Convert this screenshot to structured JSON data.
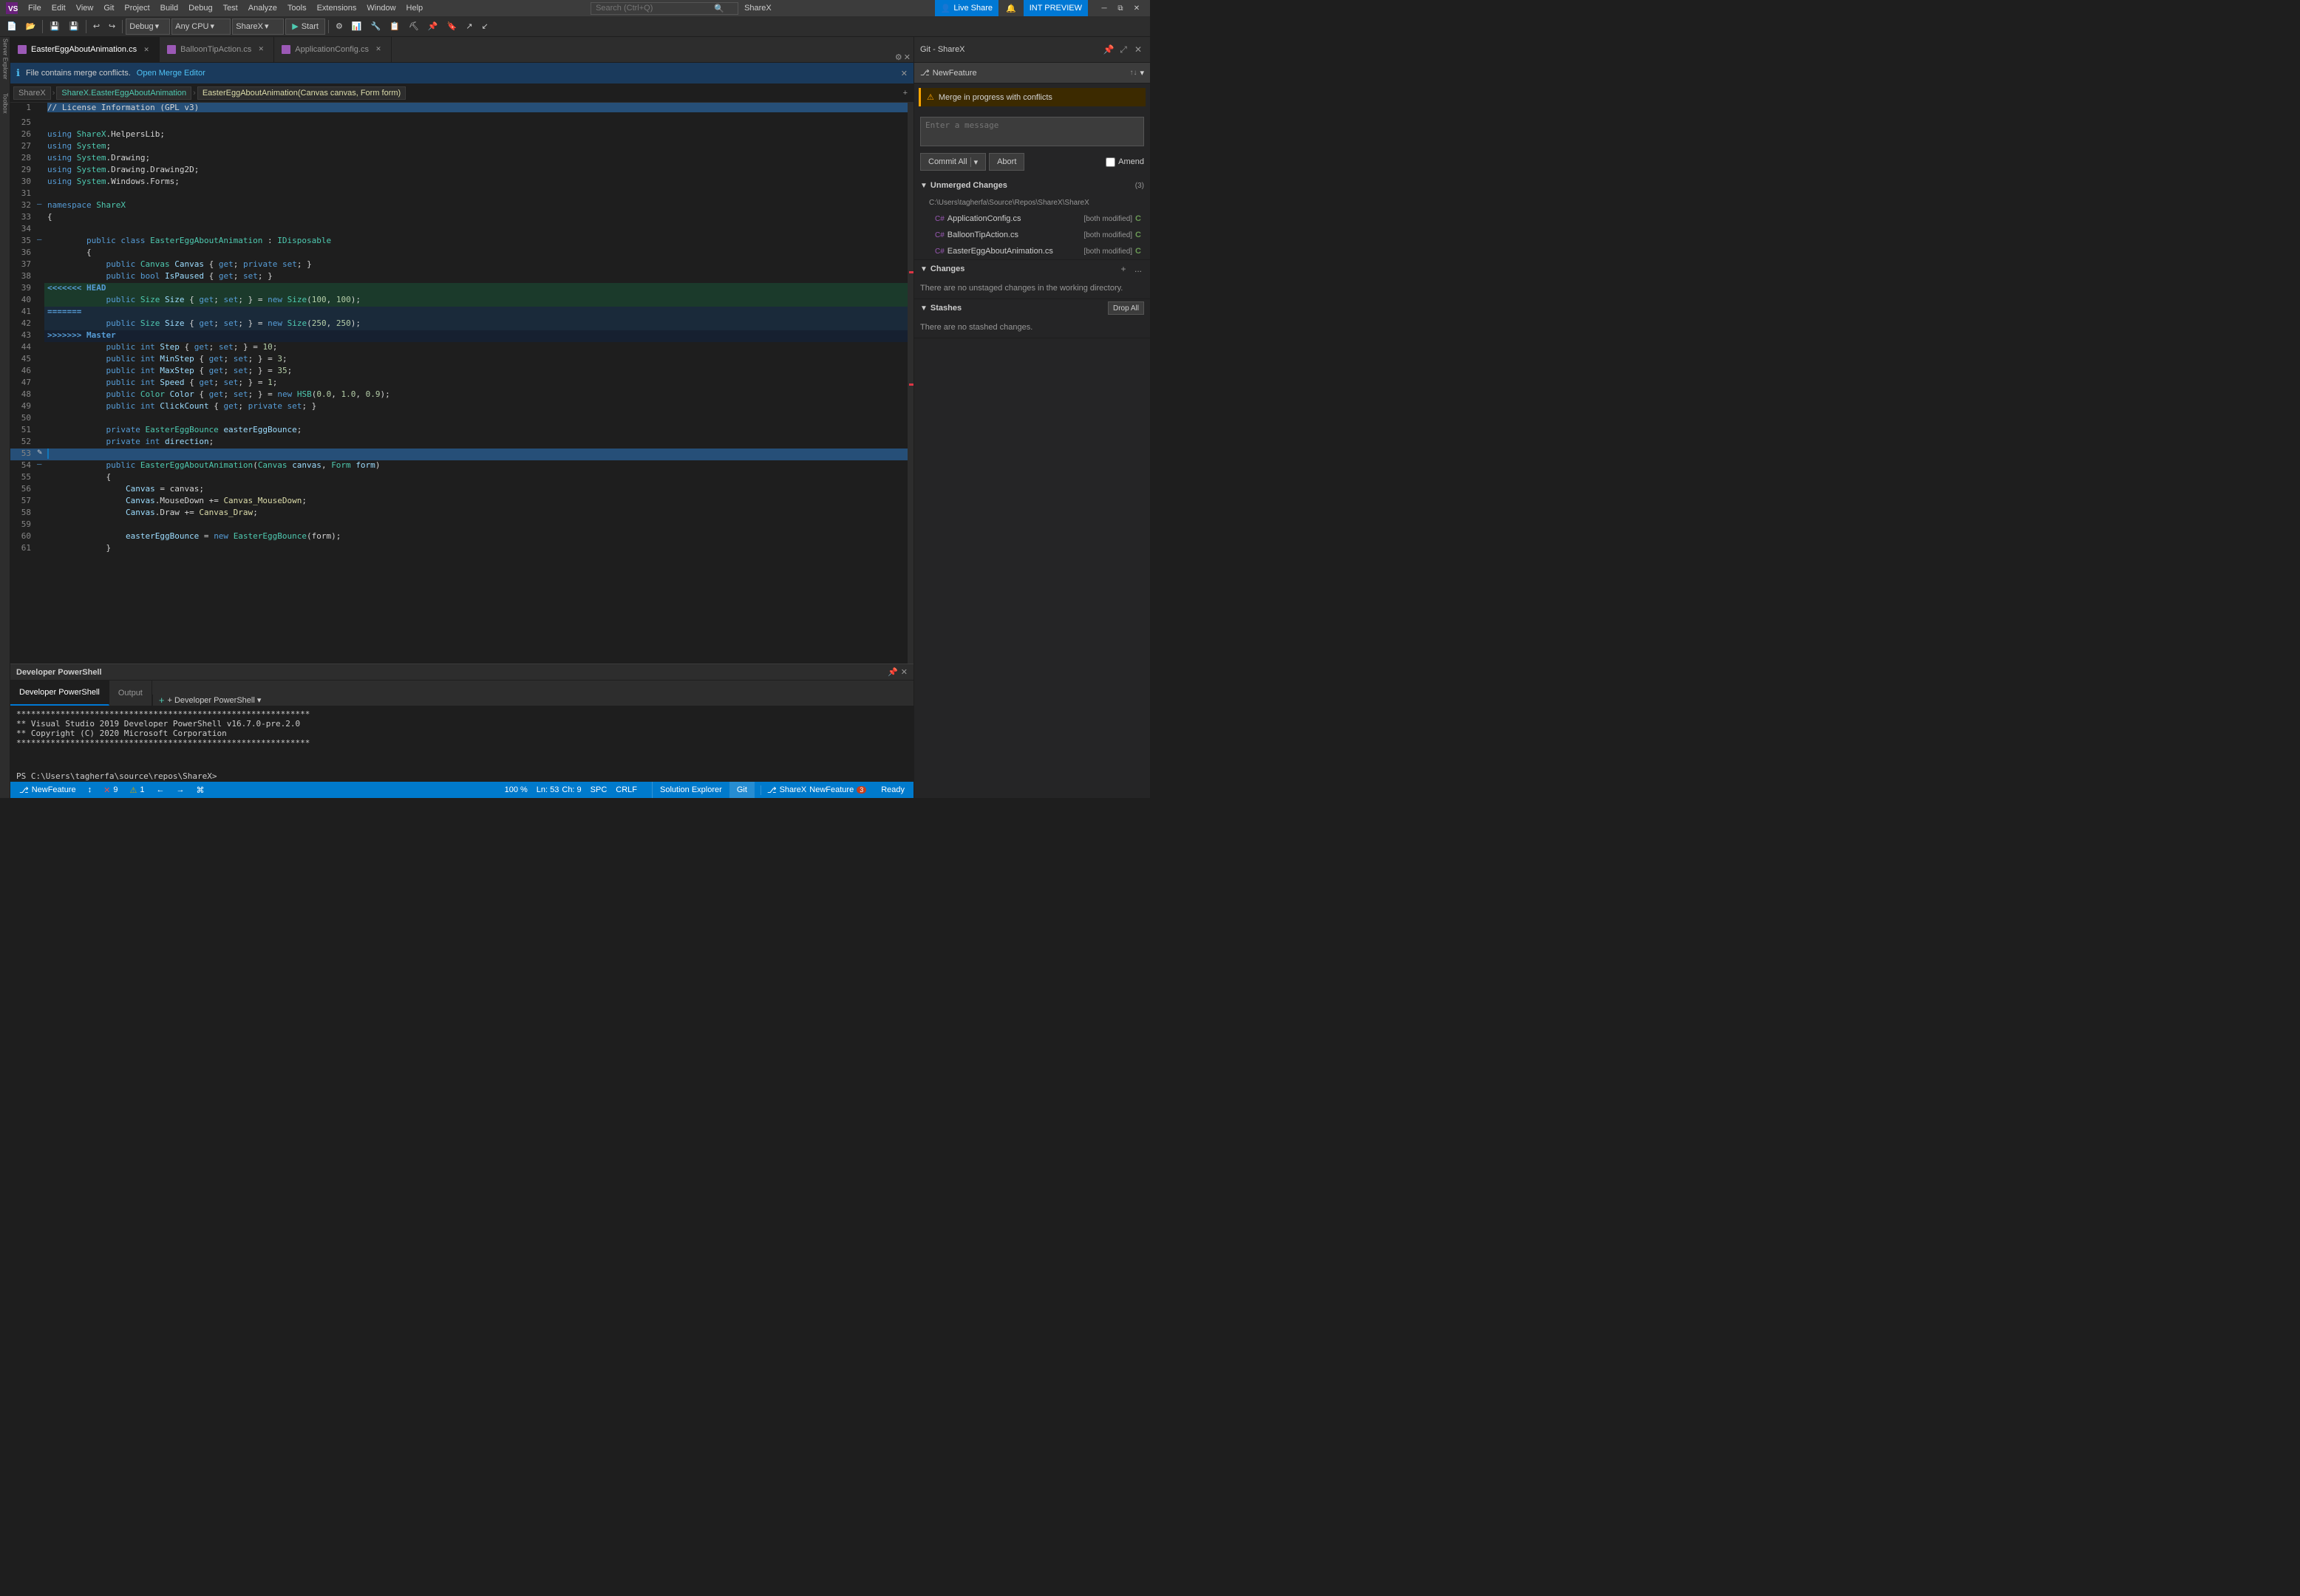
{
  "titleBar": {
    "appName": "ShareX",
    "menuItems": [
      "File",
      "Edit",
      "View",
      "Git",
      "Project",
      "Build",
      "Debug",
      "Test",
      "Analyze",
      "Tools",
      "Extensions",
      "Window",
      "Help"
    ],
    "searchPlaceholder": "Search (Ctrl+Q)",
    "searchText": "",
    "controls": [
      "minimize",
      "restore",
      "close"
    ]
  },
  "toolbar": {
    "debugConfig": "Debug",
    "platform": "Any CPU",
    "startProject": "ShareX",
    "startLabel": "Start",
    "liveShareLabel": "Live Share",
    "intPreviewLabel": "INT PREVIEW"
  },
  "tabs": [
    {
      "label": "EasterEggAboutAnimation.cs",
      "active": true,
      "modified": false
    },
    {
      "label": "BalloonTipAction.cs",
      "active": false,
      "modified": false
    },
    {
      "label": "ApplicationConfig.cs",
      "active": false,
      "modified": false
    }
  ],
  "mergeBar": {
    "icon": "ℹ",
    "text": "File contains merge conflicts.",
    "linkText": "Open Merge Editor",
    "closeIcon": "✕"
  },
  "breadcrumb": {
    "project": "ShareX",
    "namespace": "ShareX.EasterEggAboutAnimation",
    "method": "EasterEggAboutAnimation(Canvas canvas, Form form)"
  },
  "codeLines": [
    {
      "num": "1",
      "text": "    // License Information (GPL v3)"
    },
    {
      "num": "25",
      "text": ""
    },
    {
      "num": "26",
      "text": "    using ShareX.HelpersLib;"
    },
    {
      "num": "27",
      "text": "    using System;"
    },
    {
      "num": "28",
      "text": "    using System.Drawing;"
    },
    {
      "num": "29",
      "text": "    using System.Drawing.Drawing2D;"
    },
    {
      "num": "30",
      "text": "    using System.Windows.Forms;"
    },
    {
      "num": "31",
      "text": ""
    },
    {
      "num": "32",
      "text": "    namespace ShareX"
    },
    {
      "num": "33",
      "text": "    {"
    },
    {
      "num": "34",
      "text": ""
    },
    {
      "num": "35",
      "text": "        public class EasterEggAboutAnimation : IDisposable"
    },
    {
      "num": "36",
      "text": "        {"
    },
    {
      "num": "37",
      "text": "            public Canvas Canvas { get; private set; }"
    },
    {
      "num": "38",
      "text": "            public bool IsPaused { get; set; }"
    },
    {
      "num": "39",
      "text": "<<<<<<< HEAD",
      "type": "conflict-head"
    },
    {
      "num": "40",
      "text": "            public Size Size { get; set; } = new Size(100, 100);"
    },
    {
      "num": "41",
      "text": "=======",
      "type": "conflict-sep"
    },
    {
      "num": "42",
      "text": "            public Size Size { get; set; } = new Size(250, 250);"
    },
    {
      "num": "43",
      "text": ">>>>>>> Master",
      "type": "conflict-end"
    },
    {
      "num": "44",
      "text": "            public int Step { get; set; } = 10;"
    },
    {
      "num": "45",
      "text": "            public int MinStep { get; set; } = 3;"
    },
    {
      "num": "46",
      "text": "            public int MaxStep { get; set; } = 35;"
    },
    {
      "num": "47",
      "text": "            public int Speed { get; set; } = 1;"
    },
    {
      "num": "48",
      "text": "            public Color Color { get; set; } = new HSB(0.0, 1.0, 0.9);"
    },
    {
      "num": "49",
      "text": "            public int ClickCount { get; private set; }"
    },
    {
      "num": "50",
      "text": ""
    },
    {
      "num": "51",
      "text": "            private EasterEggBounce easterEggBounce;"
    },
    {
      "num": "52",
      "text": "            private int direction;"
    },
    {
      "num": "53",
      "text": ""
    },
    {
      "num": "54",
      "text": "            public EasterEggAboutAnimation(Canvas canvas, Form form)"
    },
    {
      "num": "55",
      "text": "            {"
    },
    {
      "num": "56",
      "text": "                Canvas = canvas;"
    },
    {
      "num": "57",
      "text": "                Canvas.MouseDown += Canvas_MouseDown;"
    },
    {
      "num": "58",
      "text": "                Canvas.Draw += Canvas_Draw;"
    },
    {
      "num": "59",
      "text": ""
    },
    {
      "num": "60",
      "text": "                easterEggBounce = new EasterEggBounce(form);"
    },
    {
      "num": "61",
      "text": "            }"
    }
  ],
  "statusBar": {
    "branch": "NewFeature",
    "syncIcon": "↕",
    "errors": "9",
    "warnings": "1",
    "backNav": "←",
    "forwardNav": "→",
    "zoom": "100 %",
    "line": "Ln: 53",
    "col": "Ch: 9",
    "space": "SPC",
    "encoding": "CRLF",
    "gitLabel": "ShareX",
    "gitBranchLabel": "NewFeature",
    "notifNum": "3"
  },
  "gitPanel": {
    "title": "Git - ShareX",
    "branch": "NewFeature",
    "mergeInProgress": "Merge in progress with conflicts",
    "messagePlaceholder": "Enter a message",
    "commitAllLabel": "Commit All",
    "commitDropdown": "▼",
    "abortLabel": "Abort",
    "amendLabel": "Amend",
    "unmergedSection": {
      "title": "Unmerged Changes",
      "count": "3",
      "repoPath": "C:\\Users\\tagherfa\\Source\\Repos\\ShareX\\ShareX",
      "files": [
        {
          "name": "ApplicationConfig.cs",
          "status": "[both modified]",
          "indicator": "C"
        },
        {
          "name": "BalloonTipAction.cs",
          "status": "[both modified]",
          "indicator": "C"
        },
        {
          "name": "EasterEggAboutAnimation.cs",
          "status": "[both modified]",
          "indicator": "C"
        }
      ]
    },
    "changesSection": {
      "title": "Changes",
      "addIcon": "+",
      "moreIcon": "...",
      "infoText": "There are no unstaged changes in the working directory."
    },
    "stashesSection": {
      "title": "Stashes",
      "dropAllLabel": "Drop All",
      "infoText": "There are no stashed changes."
    }
  },
  "bottomPanel": {
    "title": "Developer PowerShell",
    "addLabel": "+ Developer PowerShell ▾",
    "tabs": [
      {
        "label": "Developer PowerShell",
        "active": true
      },
      {
        "label": "Output",
        "active": false
      }
    ],
    "content": [
      "************************************************************",
      "** Visual Studio 2019 Developer PowerShell v16.7.0-pre.2.0",
      "** Copyright (C) 2020 Microsoft Corporation",
      "************************************************************",
      "PS C:\\Users\\tagherfa\\source\\repos\\ShareX>"
    ]
  },
  "bottomStatusBar": {
    "readyLabel": "Ready",
    "solutionExplorer": "Solution Explorer",
    "gitLabel": "Git",
    "gitBranchStatus": "ShareX",
    "branchName": "NewFeature",
    "notifCount": "3"
  }
}
